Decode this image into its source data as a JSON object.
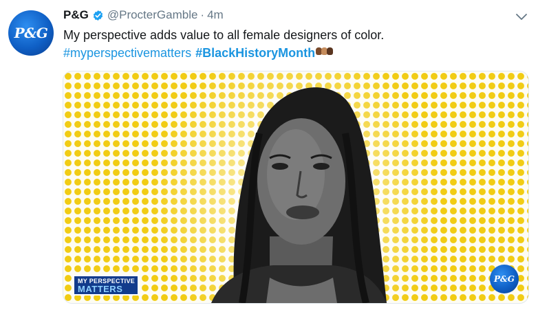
{
  "tweet": {
    "avatar_text": "P&G",
    "author_name": "P&G",
    "handle": "@ProcterGamble",
    "separator": "·",
    "time": "4m",
    "text": "My perspective adds value to all female designers of color.",
    "hashtags": [
      "#myperspectivematters",
      "#BlackHistoryMonth"
    ],
    "emoji": "raised-fists-emoji"
  },
  "media": {
    "badge_line1": "MY PERSPECTIVE",
    "badge_line2": "MATTERS",
    "logo_text": "P&G"
  },
  "colors": {
    "link": "#1b95e0",
    "verified": "#1da1f2",
    "muted": "#657786",
    "dots": "#f1cc14",
    "brand_blue": "#0f5fc5"
  },
  "icons": [
    "verified-badge-icon",
    "chevron-down-icon",
    "raised-fists-emoji"
  ]
}
